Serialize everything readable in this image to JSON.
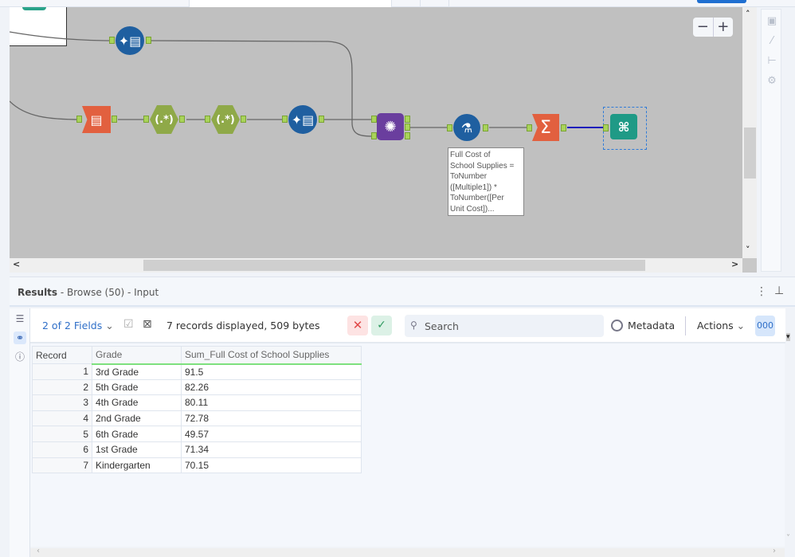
{
  "canvas": {
    "zoom_out": "−",
    "zoom_in": "+",
    "annotation": "Full Cost of\nSchool Supplies =\nToNumber\n([Multiple1]) *\nToNumber([Per\nUnit Cost])...",
    "tools": [
      {
        "name": "data-cleansing-tool-top",
        "icon": "data-cleansing-icon"
      },
      {
        "name": "select-tool",
        "icon": "select-icon"
      },
      {
        "name": "regex-tool-1",
        "icon": "regex-icon",
        "label": "(.*)"
      },
      {
        "name": "regex-tool-2",
        "icon": "regex-icon",
        "label": "(.*)"
      },
      {
        "name": "data-cleansing-tool",
        "icon": "data-cleansing-icon"
      },
      {
        "name": "join-tool",
        "icon": "join-icon"
      },
      {
        "name": "formula-tool",
        "icon": "formula-icon"
      },
      {
        "name": "summarize-tool",
        "icon": "sigma-icon",
        "label": "Σ"
      },
      {
        "name": "browse-tool",
        "icon": "binoculars-icon"
      }
    ],
    "join_anchors": {
      "l": "L",
      "r": "R",
      "j": "J"
    }
  },
  "results": {
    "title": "Results",
    "subtitle": " - Browse (50) - Input",
    "fields_label": "2 of 2 Fields",
    "records_info": "7 records displayed, 509 bytes",
    "search_placeholder": "Search",
    "metadata_label": "Metadata",
    "actions_label": "Actions",
    "cell_view_label": "000",
    "columns": [
      "Record",
      "Grade",
      "Sum_Full Cost of School Supplies"
    ],
    "rows": [
      [
        "1",
        "3rd Grade",
        "91.5"
      ],
      [
        "2",
        "5th Grade",
        "82.26"
      ],
      [
        "3",
        "4th Grade",
        "80.11"
      ],
      [
        "4",
        "2nd Grade",
        "72.78"
      ],
      [
        "5",
        "6th Grade",
        "49.57"
      ],
      [
        "6",
        "1st Grade",
        "71.34"
      ],
      [
        "7",
        "Kindergarten",
        "70.15"
      ]
    ]
  },
  "colors": {
    "canvas": "#c0c0c0",
    "accent": "#2f7bd8",
    "anchor": "#a9d35a"
  }
}
